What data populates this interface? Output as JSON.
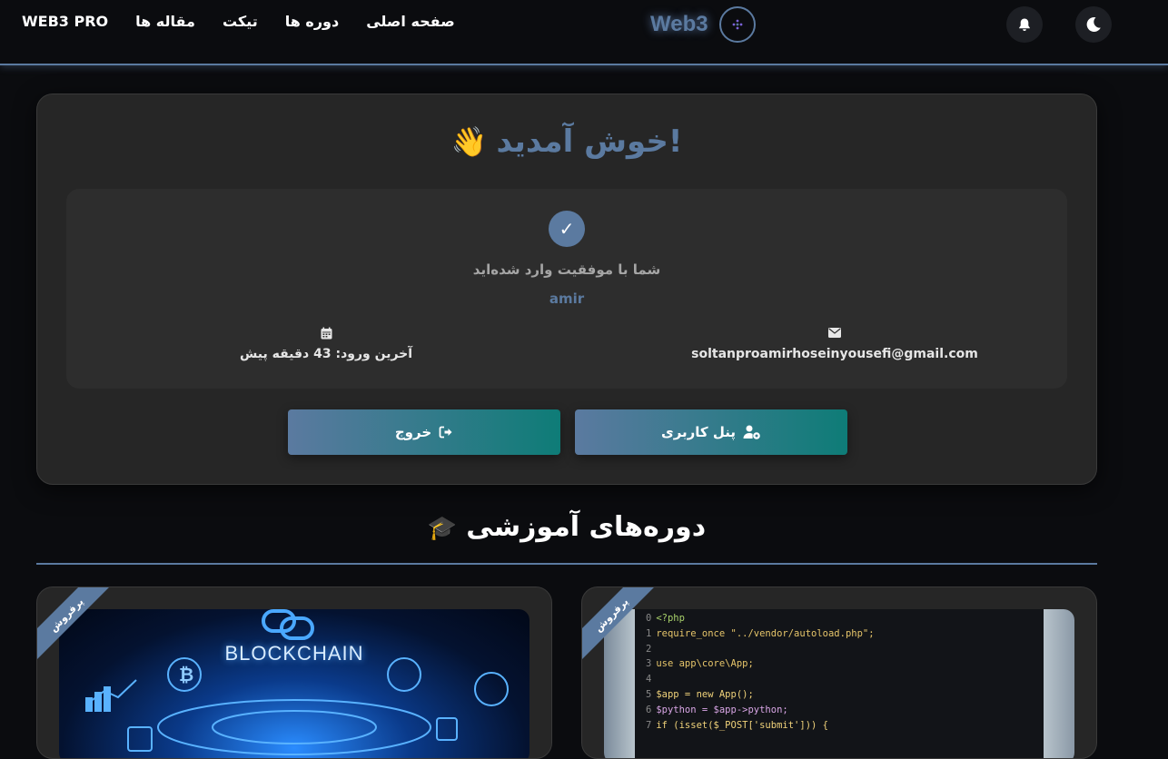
{
  "nav": {
    "links": [
      "WEB3 PRO",
      "مقاله ها",
      "تیکت",
      "دوره ها",
      "صفحه اصلی"
    ],
    "brand": "Web3"
  },
  "welcome_card": {
    "title": "خوش آمدید!",
    "wave_emoji": "👋",
    "success_message": "شما با موفقیت وارد شده‌اید",
    "username": "amir",
    "email": "soltanproamirhoseinyousefi@gmail.com",
    "last_login": "آخرین ورود: 43 دقیقه پیش",
    "panel_button": "پنل کاربری",
    "logout_button": "خروج"
  },
  "courses_section": {
    "title": "دوره‌های آموزشی",
    "cap_emoji": "🎓"
  },
  "courses": [
    {
      "badge": "پرفروش",
      "thumb_text": "BLOCKCHAIN"
    },
    {
      "badge": "پرفروش",
      "code_lines": [
        {
          "n": "0",
          "t": "<?php"
        },
        {
          "n": "1",
          "t": "require_once \"../vendor/autoload.php\";"
        },
        {
          "n": "2",
          "t": ""
        },
        {
          "n": "3",
          "t": "use app\\core\\App;"
        },
        {
          "n": "4",
          "t": ""
        },
        {
          "n": "5",
          "t": "$app = new App();"
        },
        {
          "n": "6",
          "t": "$python = $app->python;"
        },
        {
          "n": "7",
          "t": "if (isset($_POST['submit'])) {"
        }
      ]
    }
  ],
  "colors": {
    "accent": "#5b7aa0",
    "teal": "#0e7c77",
    "background": "#0b0c0f",
    "card": "#262626"
  },
  "icons": [
    "bell-icon",
    "moon-icon",
    "check-icon",
    "calendar-icon",
    "envelope-icon",
    "user-gear-icon",
    "logout-icon"
  ]
}
